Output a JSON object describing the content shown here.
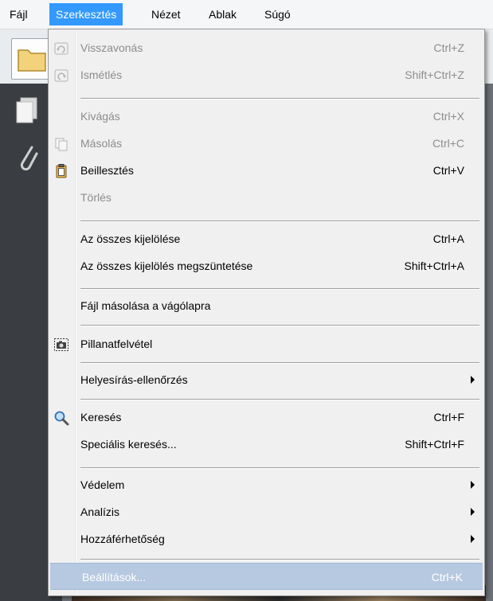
{
  "menubar": {
    "items": [
      {
        "label": "Fájl"
      },
      {
        "label": "Szerkesztés"
      },
      {
        "label": "Nézet"
      },
      {
        "label": "Ablak"
      },
      {
        "label": "Súgó"
      }
    ]
  },
  "edit_menu": {
    "items": [
      {
        "label": "Visszavonás",
        "shortcut": "Ctrl+Z",
        "icon": "undo-icon",
        "enabled": false
      },
      {
        "label": "Ismétlés",
        "shortcut": "Shift+Ctrl+Z",
        "icon": "redo-icon",
        "enabled": false
      },
      {
        "label": "Kivágás",
        "shortcut": "Ctrl+X",
        "enabled": false
      },
      {
        "label": "Másolás",
        "shortcut": "Ctrl+C",
        "icon": "copy-icon",
        "enabled": false
      },
      {
        "label": "Beillesztés",
        "shortcut": "Ctrl+V",
        "icon": "paste-icon",
        "enabled": true
      },
      {
        "label": "Törlés",
        "shortcut": "",
        "enabled": false
      },
      {
        "label": "Az összes kijelölése",
        "shortcut": "Ctrl+A",
        "enabled": true
      },
      {
        "label": "Az összes kijelölés megszüntetése",
        "shortcut": "Shift+Ctrl+A",
        "enabled": true
      },
      {
        "label": "Fájl másolása a vágólapra",
        "shortcut": "",
        "enabled": true
      },
      {
        "label": "Pillanatfelvétel",
        "shortcut": "",
        "icon": "camera-icon",
        "enabled": true
      },
      {
        "label": "Helyesírás-ellenőrzés",
        "shortcut": "",
        "submenu": true,
        "enabled": true
      },
      {
        "label": "Keresés",
        "shortcut": "Ctrl+F",
        "icon": "magnifier-icon",
        "enabled": true
      },
      {
        "label": "Speciális keresés...",
        "shortcut": "Shift+Ctrl+F",
        "enabled": true
      },
      {
        "label": "Védelem",
        "shortcut": "",
        "submenu": true,
        "enabled": true
      },
      {
        "label": "Analízis",
        "shortcut": "",
        "submenu": true,
        "enabled": true
      },
      {
        "label": "Hozzáférhetőség",
        "shortcut": "",
        "submenu": true,
        "enabled": true
      },
      {
        "label": "Beállítások...",
        "shortcut": "Ctrl+K",
        "enabled": true,
        "highlighted": true
      }
    ]
  },
  "colors": {
    "menubar_active": "#3399ff",
    "hover": "#b7c9e0",
    "disabled_text": "#8d8d8d"
  }
}
